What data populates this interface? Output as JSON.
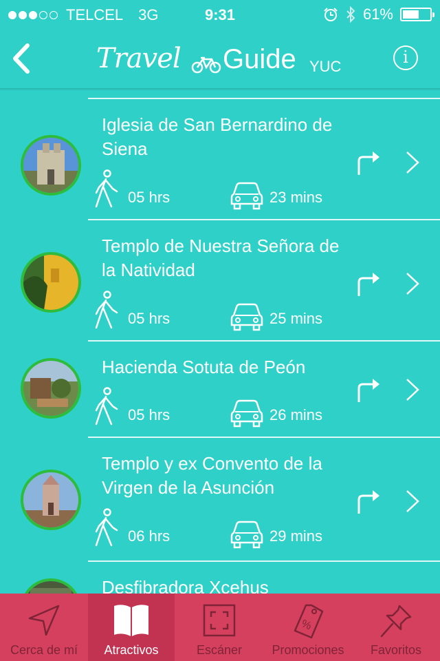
{
  "status_bar": {
    "carrier": "TELCEL",
    "network": "3G",
    "time": "9:31",
    "battery_percent": "61%",
    "battery_level": 0.61,
    "signal_bars_on": 3,
    "signal_bars_total": 5
  },
  "header": {
    "logo_travel": "Travel",
    "logo_guide": "Guide",
    "logo_region": "YUC",
    "info_label": "i"
  },
  "list": {
    "items": [
      {
        "title": "Iglesia de San Bernardino de Siena",
        "walk_time": "05 hrs",
        "car_time": "23 mins"
      },
      {
        "title": "Templo de Nuestra Señora de la Natividad",
        "walk_time": "05 hrs",
        "car_time": "25 mins"
      },
      {
        "title": "Hacienda Sotuta de Peón",
        "walk_time": "05 hrs",
        "car_time": "26 mins"
      },
      {
        "title": "Templo y ex Convento de la Virgen de la Asunción",
        "walk_time": "06 hrs",
        "car_time": "29 mins"
      },
      {
        "title": "Desfibradora Xcehus",
        "walk_time": "",
        "car_time": ""
      }
    ]
  },
  "tabbar": {
    "tabs": [
      {
        "label": "Cerca de mí",
        "icon": "navigation-arrow-icon",
        "active": false
      },
      {
        "label": "Atractivos",
        "icon": "book-icon",
        "active": true
      },
      {
        "label": "Escáner",
        "icon": "scanner-frame-icon",
        "active": false
      },
      {
        "label": "Promociones",
        "icon": "price-tag-icon",
        "active": false
      },
      {
        "label": "Favoritos",
        "icon": "pushpin-icon",
        "active": false
      }
    ]
  },
  "colors": {
    "background": "#2fd0c8",
    "tabbar": "#d6405f",
    "tab_active": "#c23352",
    "avatar_ring": "#2dbc3c"
  }
}
